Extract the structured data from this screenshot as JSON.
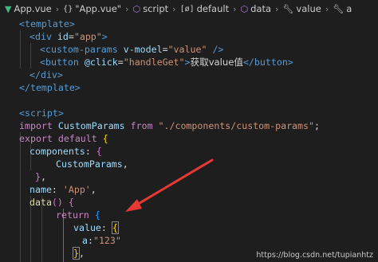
{
  "breadcrumb": {
    "file": "App.vue",
    "items": [
      "\"App.vue\"",
      "script",
      "default",
      "data",
      "value",
      "a"
    ],
    "icons": [
      "vue-icon",
      "braces-icon",
      "cube-icon",
      "object-icon",
      "cube-icon",
      "wrench-icon",
      "wrench-icon"
    ]
  },
  "code": {
    "template_open": "<template>",
    "div_open_tag": "<div",
    "div_id_attr": "id",
    "div_id_val": "\"app\"",
    "custom_params_tag": "<custom-params",
    "vmodel_attr": "v-model",
    "vmodel_val": "\"value\"",
    "self_close": "/>",
    "button_tag": "<button",
    "click_attr": "@click",
    "click_val": "\"handleGet\"",
    "button_text": "获取value值",
    "button_close": "</button>",
    "div_close": "</div>",
    "template_close": "</template>",
    "script_open": "<script>",
    "import_kw": "import",
    "import_name": "CustomParams",
    "from_kw": "from",
    "import_path": "\"./components/custom-params\"",
    "export_kw": "export",
    "default_kw": "default",
    "components_key": "components",
    "components_item": "CustomParams",
    "name_key": "name",
    "name_val": "'App'",
    "data_fn": "data",
    "return_kw": "return",
    "value_key": "value",
    "a_key": "a",
    "a_val": "\"123\""
  },
  "colors": {
    "background": "#1e1e1e",
    "tag": "#569cd6",
    "attribute": "#9cdcfe",
    "string": "#ce9178",
    "keyword": "#c586c0",
    "class": "#4ec9b0",
    "function": "#dcdcaa",
    "arrow": "#e53935"
  },
  "watermark": "https://blog.csdn.net/tupianhtz"
}
